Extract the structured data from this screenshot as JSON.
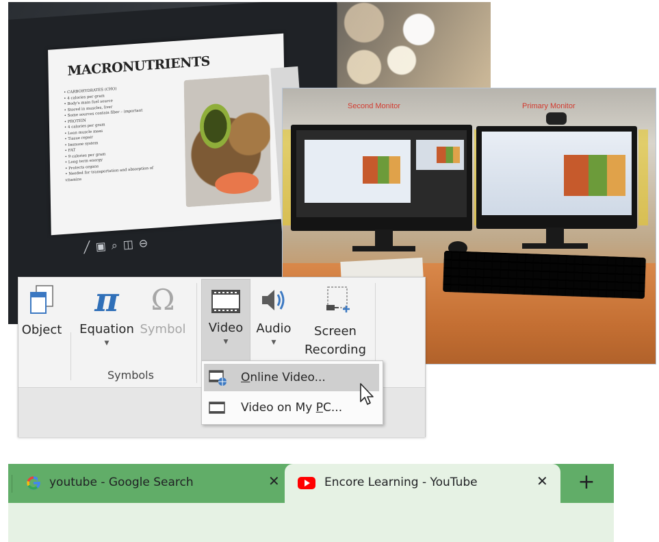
{
  "photo_laptop": {
    "slide_title": "MACRONUTRIENTS",
    "bullets": [
      "• CARBOHYDRATES (CHO)",
      "   • 4 calories per gram",
      "   • Body's main fuel source",
      "   • Stored in muscles, liver",
      "   • Some sources contain fiber – important",
      "• PROTEIN",
      "   • 4 calories per gram",
      "   • Lean muscle mass",
      "   • Tissue repair",
      "   • Immune system",
      "• FAT",
      "   • 9 calories per gram",
      "   • Long term energy",
      "   • Protects organs",
      "   • Needed for transportation and absorption of",
      "     vitamins"
    ]
  },
  "photo_monitors": {
    "left_label": "Second Monitor",
    "right_label": "Primary Monitor"
  },
  "ribbon": {
    "buttons": {
      "object": "Object",
      "equation": "Equation",
      "symbol": "Symbol",
      "video": "Video",
      "audio": "Audio",
      "screen_recording_line1": "Screen",
      "screen_recording_line2": "Recording"
    },
    "group_label": "Symbols",
    "equation_glyph": "π",
    "symbol_glyph": "Ω",
    "dropdown_arrow": "▼"
  },
  "video_menu": {
    "online_video_accel": "O",
    "online_video_rest": "nline Video...",
    "my_pc_pre": "Video on My ",
    "my_pc_accel": "P",
    "my_pc_rest": "C..."
  },
  "chrome": {
    "tabs": [
      {
        "title": "youtube - Google Search",
        "favicon": "google-g-icon",
        "active": false
      },
      {
        "title": "Encore Learning - YouTube",
        "favicon": "youtube-icon",
        "active": true
      }
    ],
    "close_glyph": "✕",
    "new_tab_glyph": "+",
    "colors": {
      "strip": "#61ad68",
      "active_tab": "#e6f2e4"
    }
  }
}
